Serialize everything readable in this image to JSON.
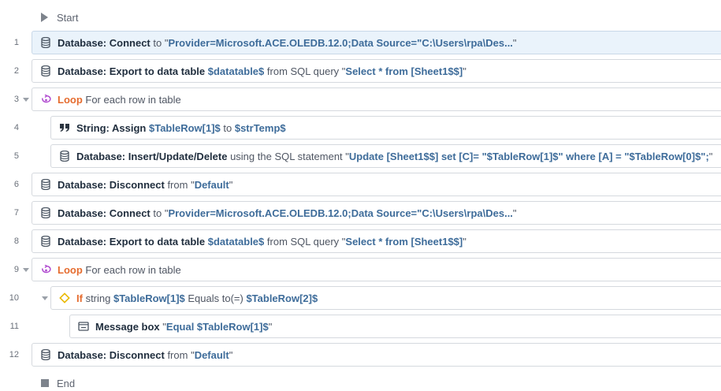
{
  "header": {
    "clipped_text": "...g...gg..."
  },
  "start_label": "Start",
  "end_label": "End",
  "rows": [
    {
      "num": "1",
      "type": "db",
      "selected": true,
      "indent": 0,
      "parts": [
        {
          "t": "Database: Connect",
          "s": "k"
        },
        {
          "t": " to ",
          "s": "n"
        },
        {
          "t": "\"",
          "s": "q"
        },
        {
          "t": "Provider=Microsoft.ACE.OLEDB.12.0;Data Source=\"C:\\Users\\rpa\\Des...",
          "s": "v"
        },
        {
          "t": "\"",
          "s": "q"
        }
      ]
    },
    {
      "num": "2",
      "type": "db",
      "indent": 0,
      "parts": [
        {
          "t": "Database: Export to data table",
          "s": "k"
        },
        {
          "t": " ",
          "s": "n"
        },
        {
          "t": "$datatable$",
          "s": "v"
        },
        {
          "t": " from SQL query ",
          "s": "n"
        },
        {
          "t": "\"",
          "s": "q"
        },
        {
          "t": "Select * from [Sheet1$$]",
          "s": "v"
        },
        {
          "t": "\"",
          "s": "q"
        }
      ]
    },
    {
      "num": "3",
      "type": "loop",
      "indent": 0,
      "collapsible": true,
      "parts": [
        {
          "t": "Loop",
          "s": "kloop"
        },
        {
          "t": " For each row in table",
          "s": "n"
        }
      ]
    },
    {
      "num": "4",
      "type": "string",
      "indent": 1,
      "parts": [
        {
          "t": "String: Assign",
          "s": "k"
        },
        {
          "t": " ",
          "s": "n"
        },
        {
          "t": "$TableRow[1]$",
          "s": "v"
        },
        {
          "t": " to ",
          "s": "n"
        },
        {
          "t": "$strTemp$",
          "s": "v"
        }
      ]
    },
    {
      "num": "5",
      "type": "db",
      "indent": 1,
      "parts": [
        {
          "t": "Database: Insert/Update/Delete",
          "s": "k"
        },
        {
          "t": " using the SQL statement ",
          "s": "n"
        },
        {
          "t": "\"",
          "s": "q"
        },
        {
          "t": "Update [Sheet1$$] set [C]= \"$TableRow[1]$\" where [A] = \"$TableRow[0]$\";",
          "s": "v"
        },
        {
          "t": "\"",
          "s": "q"
        }
      ]
    },
    {
      "num": "6",
      "type": "db",
      "indent": 0,
      "parts": [
        {
          "t": "Database: Disconnect",
          "s": "k"
        },
        {
          "t": " from ",
          "s": "n"
        },
        {
          "t": "\"",
          "s": "q"
        },
        {
          "t": "Default",
          "s": "v"
        },
        {
          "t": "\"",
          "s": "q"
        }
      ]
    },
    {
      "num": "7",
      "type": "db",
      "indent": 0,
      "parts": [
        {
          "t": "Database: Connect",
          "s": "k"
        },
        {
          "t": " to ",
          "s": "n"
        },
        {
          "t": "\"",
          "s": "q"
        },
        {
          "t": "Provider=Microsoft.ACE.OLEDB.12.0;Data Source=\"C:\\Users\\rpa\\Des...",
          "s": "v"
        },
        {
          "t": "\"",
          "s": "q"
        }
      ]
    },
    {
      "num": "8",
      "type": "db",
      "indent": 0,
      "parts": [
        {
          "t": "Database: Export to data table",
          "s": "k"
        },
        {
          "t": " ",
          "s": "n"
        },
        {
          "t": "$datatable$",
          "s": "v"
        },
        {
          "t": " from SQL query ",
          "s": "n"
        },
        {
          "t": "\"",
          "s": "q"
        },
        {
          "t": "Select * from [Sheet1$$]",
          "s": "v"
        },
        {
          "t": "\"",
          "s": "q"
        }
      ]
    },
    {
      "num": "9",
      "type": "loop",
      "indent": 0,
      "collapsible": true,
      "parts": [
        {
          "t": "Loop",
          "s": "kloop"
        },
        {
          "t": " For each row in table",
          "s": "n"
        }
      ]
    },
    {
      "num": "10",
      "type": "if",
      "indent": 1,
      "collapsible": true,
      "parts": [
        {
          "t": "If",
          "s": "kif"
        },
        {
          "t": " string ",
          "s": "n"
        },
        {
          "t": "$TableRow[1]$",
          "s": "v"
        },
        {
          "t": " Equals to(=) ",
          "s": "n"
        },
        {
          "t": "$TableRow[2]$",
          "s": "v"
        }
      ]
    },
    {
      "num": "11",
      "type": "msg",
      "indent": 2,
      "parts": [
        {
          "t": "Message box",
          "s": "k"
        },
        {
          "t": " ",
          "s": "n"
        },
        {
          "t": "\"",
          "s": "q"
        },
        {
          "t": "Equal $TableRow[1]$",
          "s": "v"
        },
        {
          "t": "\"",
          "s": "q"
        }
      ]
    },
    {
      "num": "12",
      "type": "db",
      "indent": 0,
      "parts": [
        {
          "t": "Database: Disconnect",
          "s": "k"
        },
        {
          "t": " from ",
          "s": "n"
        },
        {
          "t": "\"",
          "s": "q"
        },
        {
          "t": "Default",
          "s": "v"
        },
        {
          "t": "\"",
          "s": "q"
        }
      ]
    }
  ],
  "colors": {
    "loop": "#e56c2f",
    "if_icon": "#e9b800",
    "value": "#3e6c9a",
    "db_icon": "#4a5562",
    "loop_icon": "#b04ad0"
  }
}
